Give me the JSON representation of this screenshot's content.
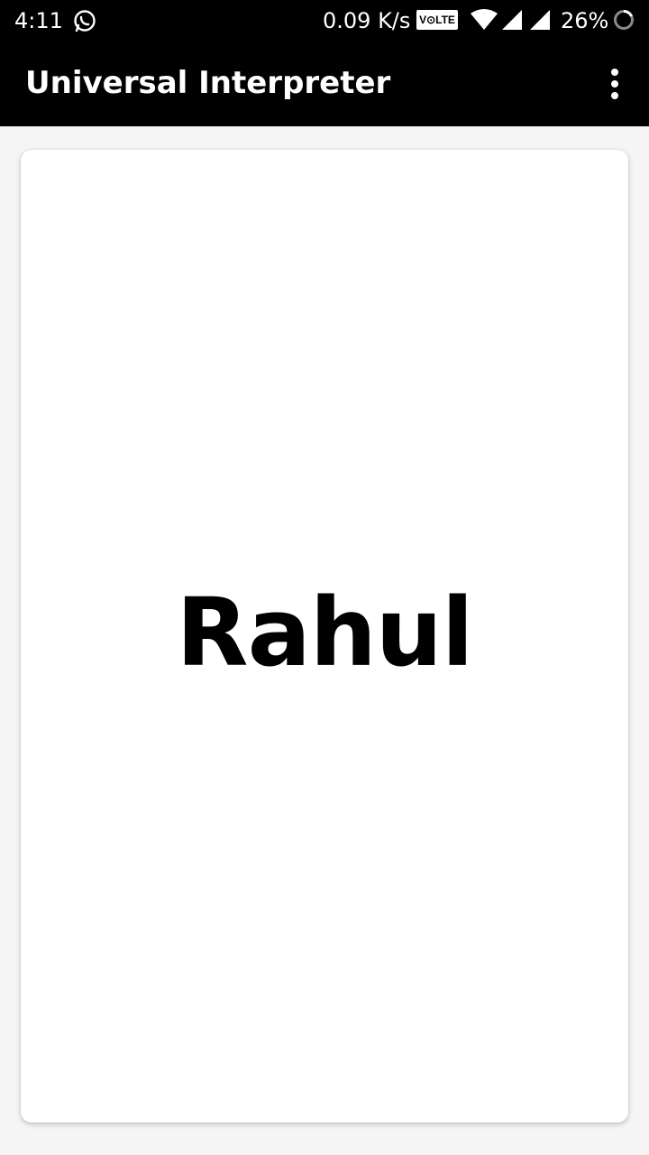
{
  "status_bar": {
    "time": "4:11",
    "network_speed": "0.09 K/s",
    "volte_badge": "V⊙LTE",
    "battery_percent": "26%",
    "icons": [
      "whatsapp-icon",
      "wifi-icon",
      "cell-signal-icon",
      "cell-signal-icon",
      "battery-icon"
    ]
  },
  "app_bar": {
    "title": "Universal Interpreter",
    "overflow_icon": "more-vert-icon"
  },
  "card": {
    "name": "Rahul"
  },
  "colors": {
    "bar_background": "#000000",
    "page_background": "#f5f5f5",
    "card_background": "#ffffff",
    "text_primary": "#000000",
    "text_on_bar": "#ffffff"
  }
}
